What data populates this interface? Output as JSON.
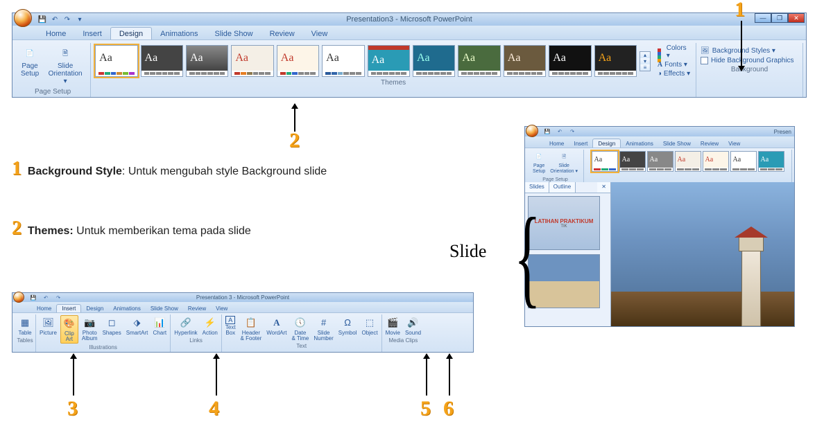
{
  "app_title": "Presentation3 - Microsoft PowerPoint",
  "app_title_small": "Presentation 3 - Microsoft PowerPoint",
  "tabs": {
    "home": "Home",
    "insert": "Insert",
    "design": "Design",
    "animations": "Animations",
    "slideshow": "Slide Show",
    "review": "Review",
    "view": "View"
  },
  "page_setup": {
    "page_setup": "Page\nSetup",
    "slide_orient": "Slide\nOrientation ▾",
    "label": "Page Setup"
  },
  "themes_label": "Themes",
  "theme_misc": {
    "colors": "Colors ▾",
    "fonts": "Fonts ▾",
    "effects": "Effects ▾"
  },
  "bg": {
    "styles": "Background Styles ▾",
    "hide": "Hide Background Graphics",
    "label": "Background"
  },
  "notes": {
    "n1_bold": "Background Style",
    "n1_rest": ": Untuk mengubah style Background slide",
    "n2_bold": "Themes:",
    "n2_rest": " Untuk memberikan tema pada slide"
  },
  "mini": {
    "slides_tab": "Slides",
    "outline_tab": "Outline",
    "thumb1_title": "LATIHAN PRAKTIKUM",
    "thumb1_sub": "TIK"
  },
  "slide_label": "Slide",
  "insert": {
    "groups": {
      "tables": "Tables",
      "illus": "Illustrations",
      "links": "Links",
      "text": "Text",
      "media": "Media Clips"
    },
    "btns": {
      "table": "Table",
      "picture": "Picture",
      "clipart": "Clip\nArt",
      "photo": "Photo\nAlbum",
      "shapes": "Shapes",
      "smartart": "SmartArt",
      "chart": "Chart",
      "hyperlink": "Hyperlink",
      "action": "Action",
      "textbox": "Text\nBox",
      "headerfooter": "Header\n& Footer",
      "wordart": "WordArt",
      "datetime": "Date\n& Time",
      "slidenum": "Slide\nNumber",
      "symbol": "Symbol",
      "object": "Object",
      "movie": "Movie",
      "sound": "Sound"
    }
  },
  "callouts": {
    "c1": "1",
    "c2": "2",
    "c3": "3",
    "c4": "4",
    "c5": "5",
    "c6": "6"
  },
  "mini_title": "Presen"
}
